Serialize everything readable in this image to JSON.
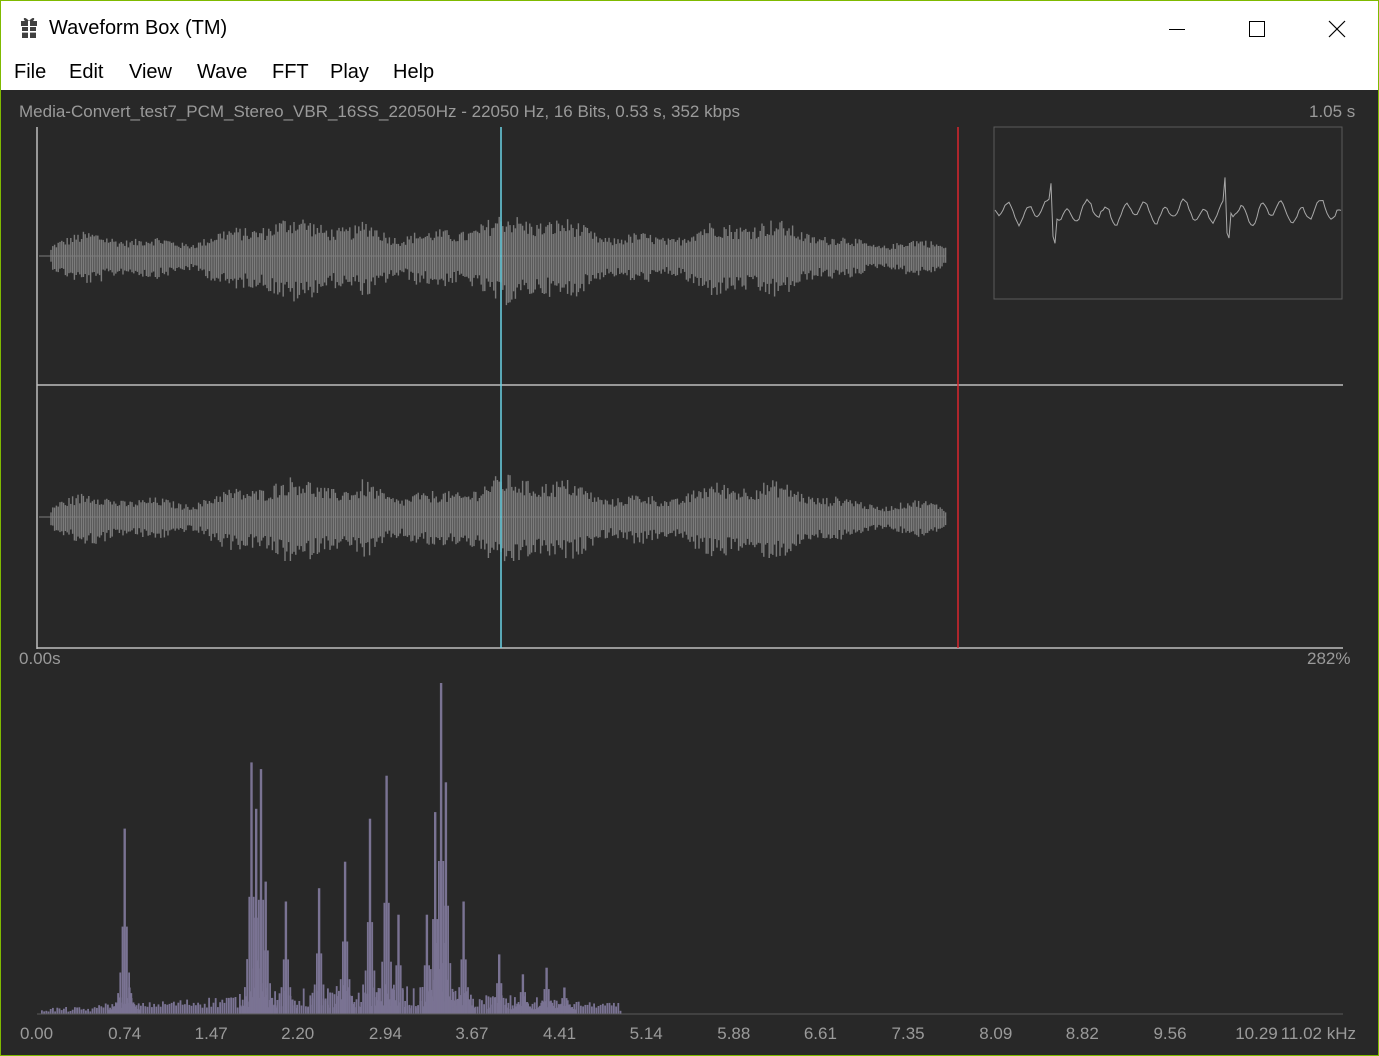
{
  "window": {
    "title": "Waveform Box (TM)",
    "border_color": "#7fba00"
  },
  "caption_buttons": {
    "minimize": "minimize-icon",
    "maximize": "maximize-icon",
    "close": "close-icon"
  },
  "menu": {
    "items": [
      "File",
      "Edit",
      "View",
      "Wave",
      "FFT",
      "Play",
      "Help"
    ]
  },
  "waveform": {
    "file_info": "Media-Convert_test7_PCM_Stereo_VBR_16SS_22050Hz - 22050 Hz, 16 Bits, 0.53 s, 352 kbps",
    "duration_label": "1.05 s",
    "start_label": "0.00s",
    "zoom_label": "282%",
    "channels": 2,
    "cursor_color": "#6ad3e6",
    "end_marker_color": "#d9262e",
    "wave_color": "#7c7c7c",
    "axis_color": "#bdbdbd"
  },
  "spectrum": {
    "bar_color": "#7a7393",
    "x_tick_labels": [
      "0.00",
      "0.74",
      "1.47",
      "2.20",
      "2.94",
      "3.67",
      "4.41",
      "5.14",
      "5.88",
      "6.61",
      "7.35",
      "8.09",
      "8.82",
      "9.56",
      "10.29"
    ],
    "x_max_label": "11.02 kHz"
  },
  "chart_data": {
    "type": "bar",
    "xlabel": "kHz",
    "xlim": [
      0,
      11.02
    ],
    "ylim": [
      0,
      1
    ],
    "x": [
      0.7,
      0.74,
      0.78,
      1.81,
      1.85,
      1.89,
      1.93,
      2.1,
      2.38,
      2.6,
      2.81,
      2.95,
      3.05,
      3.29,
      3.36,
      3.41,
      3.45,
      3.6,
      3.9,
      4.1,
      4.3,
      4.45
    ],
    "values": [
      0.05,
      0.56,
      0.08,
      0.76,
      0.62,
      0.74,
      0.4,
      0.34,
      0.38,
      0.46,
      0.59,
      0.72,
      0.3,
      0.3,
      0.61,
      1.0,
      0.7,
      0.34,
      0.18,
      0.12,
      0.14,
      0.08
    ]
  }
}
